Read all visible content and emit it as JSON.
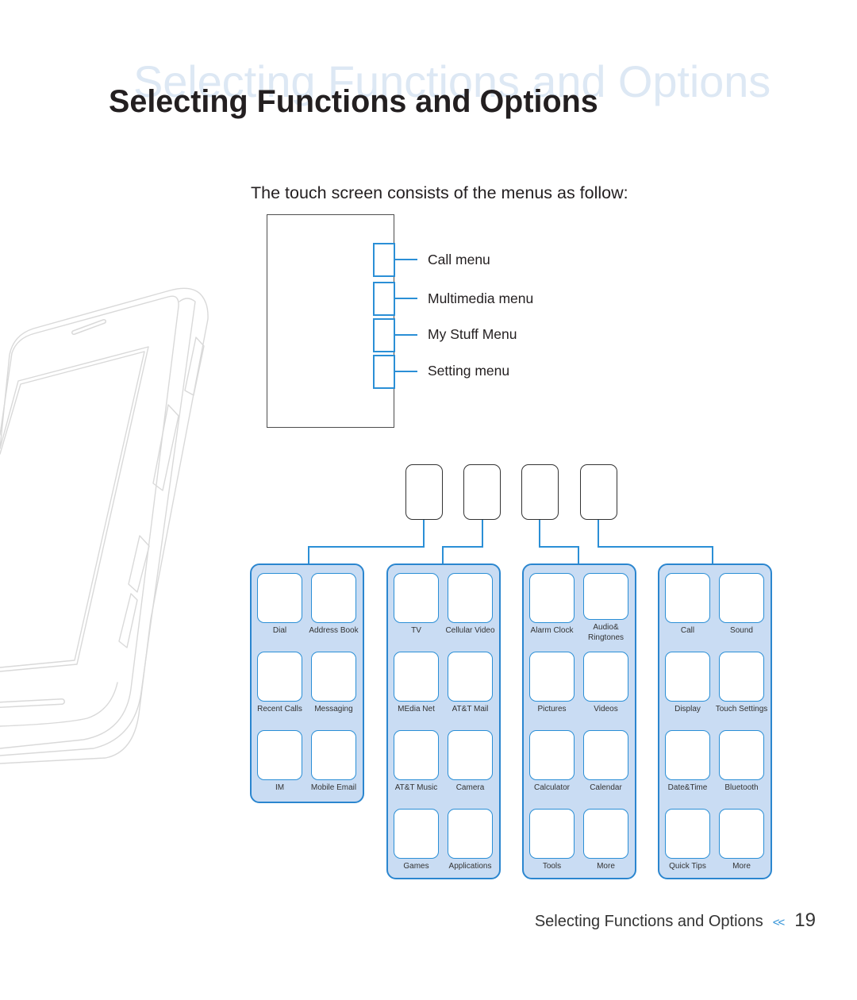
{
  "page": {
    "title": "Selecting Functions and Options",
    "title_ghost": "Selecting Functions and Options",
    "intro": "The touch screen consists of the menus as follow:"
  },
  "screen_diagram": {
    "menus": [
      {
        "label": "Call menu"
      },
      {
        "label": "Multimedia menu"
      },
      {
        "label": "My Stuff Menu"
      },
      {
        "label": "Setting menu"
      }
    ]
  },
  "menu_groups": [
    {
      "name": "Call menu",
      "items": [
        "Dial",
        "Address Book",
        "Recent Calls",
        "Messaging",
        "IM",
        "Mobile Email"
      ]
    },
    {
      "name": "Multimedia menu",
      "items": [
        "TV",
        "Cellular Video",
        "MEdia Net",
        "AT&T Mail",
        "AT&T Music",
        "Camera",
        "Games",
        "Applications"
      ]
    },
    {
      "name": "My Stuff Menu",
      "items": [
        "Alarm Clock",
        "Audio&\nRingtones",
        "Pictures",
        "Videos",
        "Calculator",
        "Calendar",
        "Tools",
        "More"
      ]
    },
    {
      "name": "Setting menu",
      "items": [
        "Call",
        "Sound",
        "Display",
        "Touch Settings",
        "Date&Time",
        "Bluetooth",
        "Quick Tips",
        "More"
      ]
    }
  ],
  "footer": {
    "section": "Selecting Functions and Options",
    "separator": "<<",
    "page_number": "19"
  },
  "colors": {
    "accent_blue": "#2b8fd6",
    "panel_fill": "#c9dcf3",
    "ghost_title": "#dde8f4",
    "text": "#231f20",
    "phone_outline": "#d9d9d9"
  }
}
